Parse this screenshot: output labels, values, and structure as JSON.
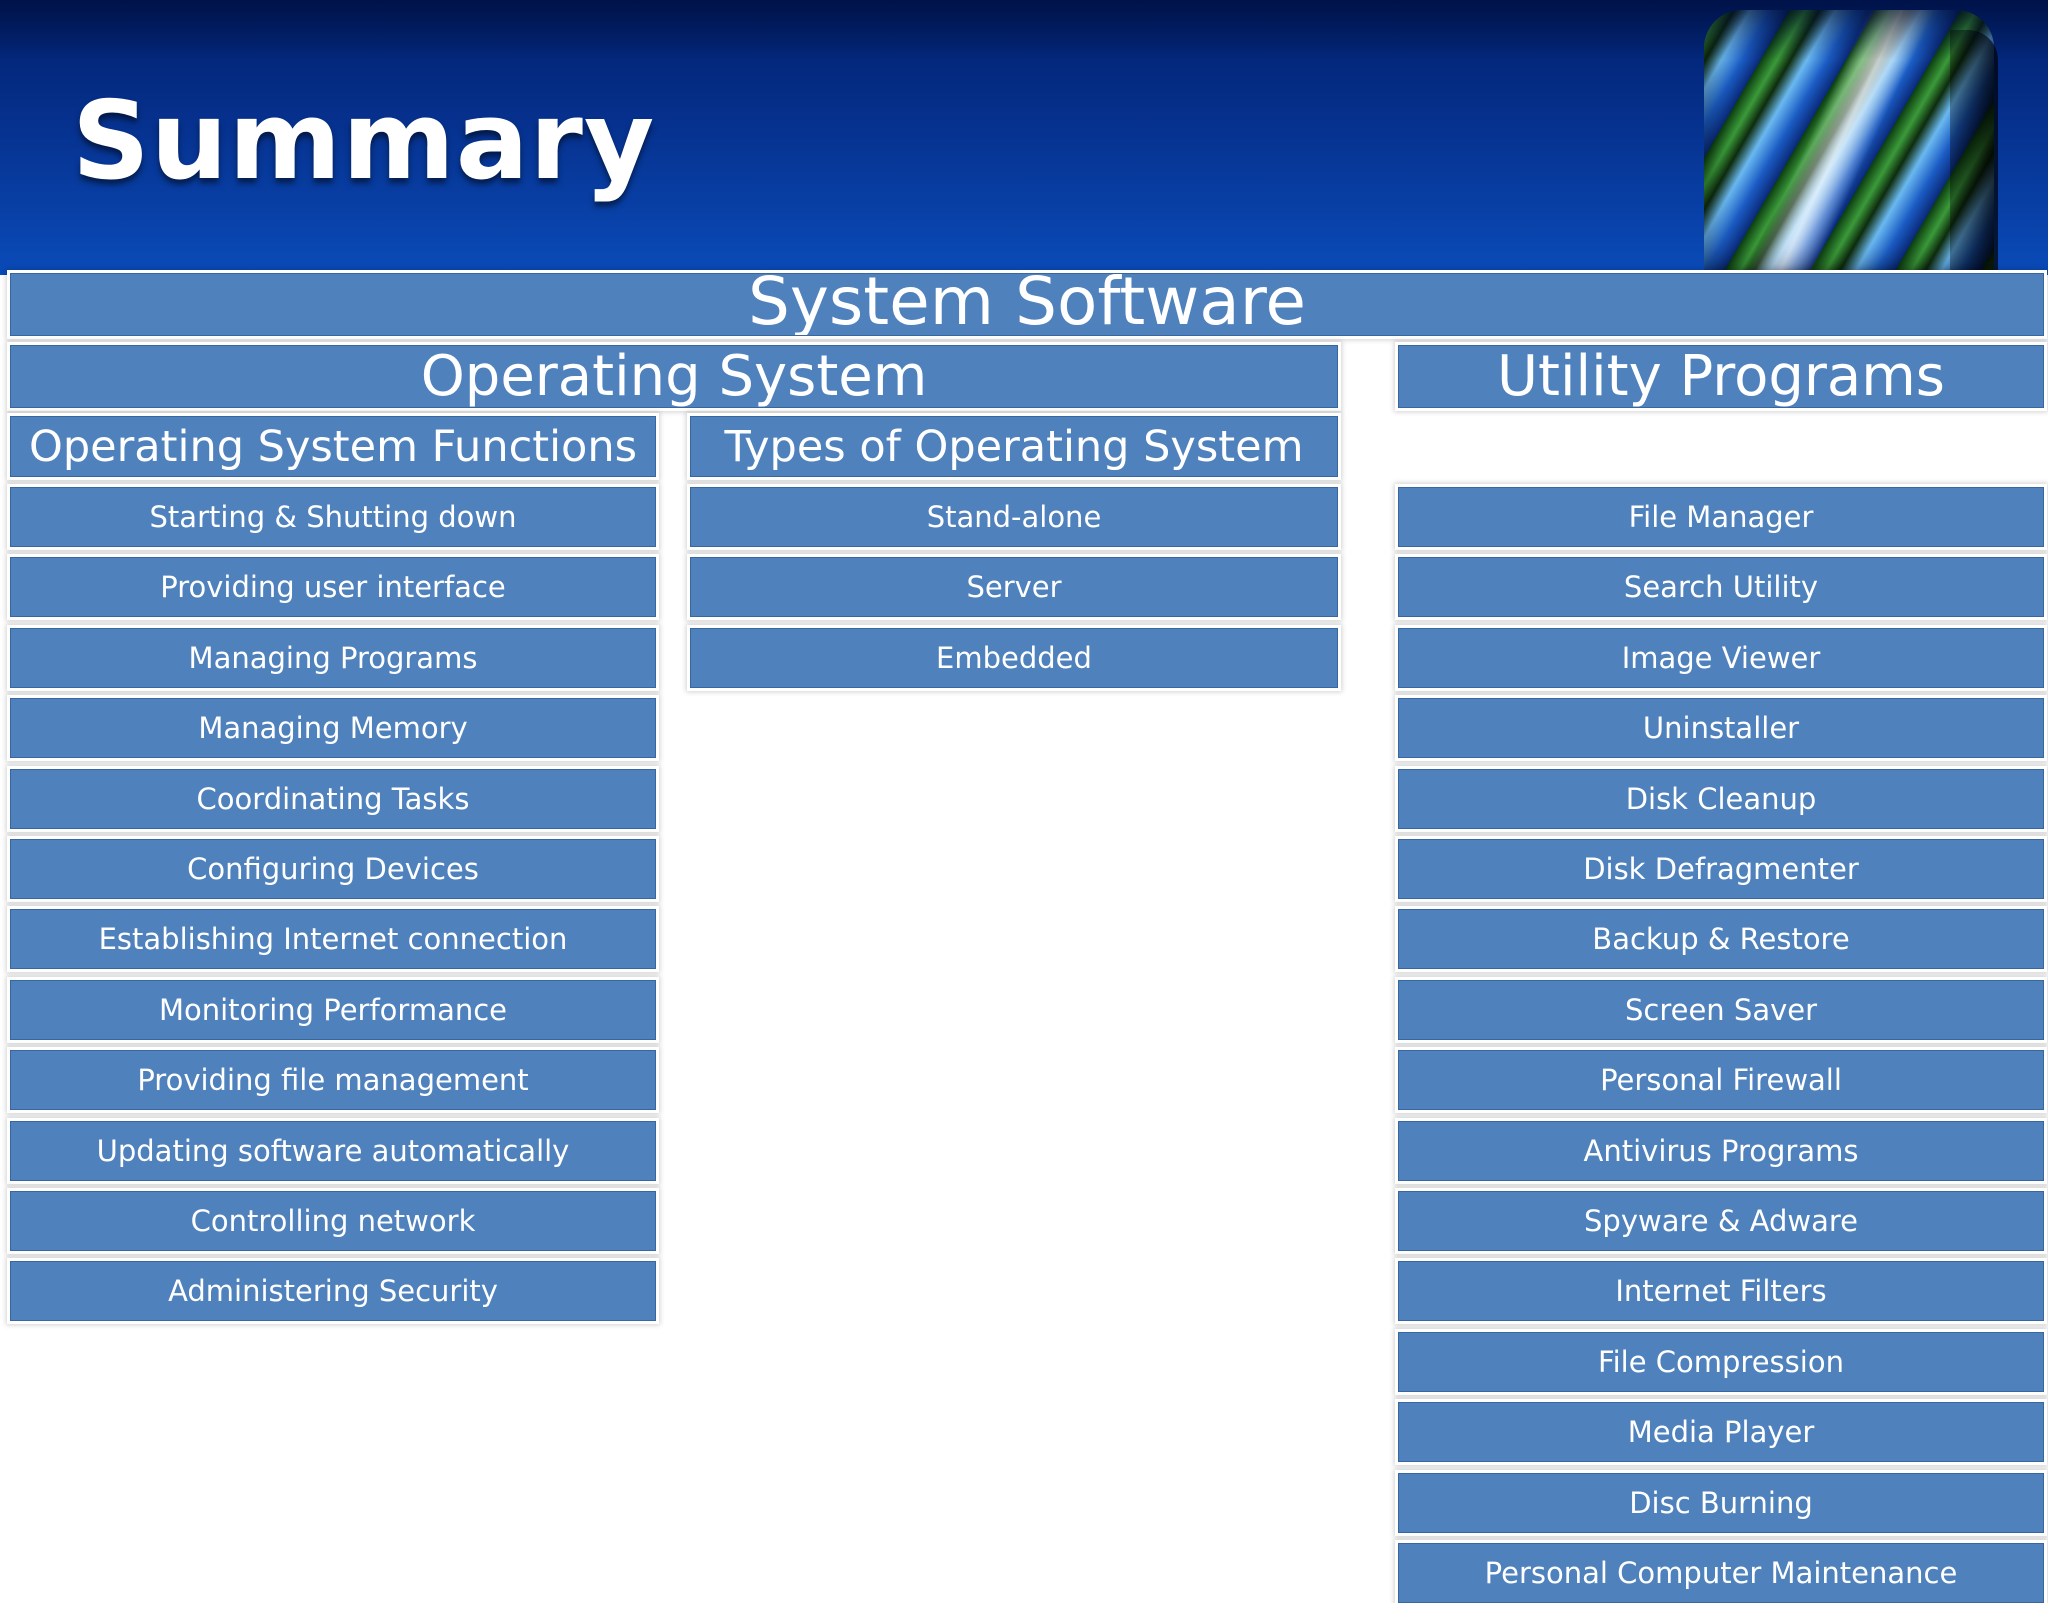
{
  "slide_title": "Summary",
  "root": "System Software",
  "operating_system": {
    "label": "Operating System",
    "functions": {
      "label": "Operating System Functions",
      "items": [
        "Starting & Shutting down",
        "Providing user interface",
        "Managing Programs",
        "Managing Memory",
        "Coordinating Tasks",
        "Configuring Devices",
        "Establishing Internet connection",
        "Monitoring Performance",
        "Providing file management",
        "Updating software automatically",
        "Controlling network",
        "Administering Security"
      ]
    },
    "types": {
      "label": "Types of Operating System",
      "items": [
        "Stand-alone",
        "Server",
        "Embedded"
      ]
    }
  },
  "utility_programs": {
    "label": "Utility Programs",
    "items": [
      "File Manager",
      "Search Utility",
      "Image Viewer",
      "Uninstaller",
      "Disk Cleanup",
      "Disk Defragmenter",
      "Backup & Restore",
      "Screen Saver",
      "Personal Firewall",
      "Antivirus Programs",
      "Spyware & Adware",
      "Internet Filters",
      "File Compression",
      "Media Player",
      "Disc Burning",
      "Personal Computer Maintenance"
    ]
  },
  "colors": {
    "box_fill": "#4f81bd",
    "header_dark": "#001f6b",
    "header_light": "#0a4bb8",
    "text": "#ffffff"
  }
}
